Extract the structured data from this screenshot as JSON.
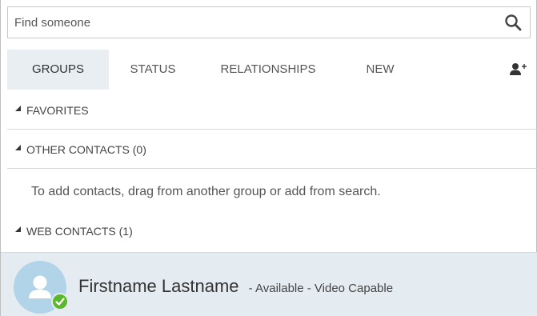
{
  "search": {
    "placeholder": "Find someone",
    "icon": "search-icon"
  },
  "tabs": [
    {
      "label": "GROUPS",
      "active": true
    },
    {
      "label": "STATUS",
      "active": false
    },
    {
      "label": "RELATIONSHIPS",
      "active": false
    },
    {
      "label": "NEW",
      "active": false
    }
  ],
  "add_contact_icon": "add-contact-icon",
  "groups": {
    "favorites": "FAVORITES",
    "other": "OTHER CONTACTS (0)",
    "web": "WEB CONTACTS (1)"
  },
  "empty_hint": "To add contacts, drag from another group or add from search.",
  "contact": {
    "name": "Firstname Lastname",
    "status": "- Available - Video Capable",
    "presence": "available",
    "presence_color": "#5cb82b",
    "avatar_color": "#b2d4e8"
  },
  "colors": {
    "active_tab_bg": "#e8eef2",
    "selected_row_bg": "#e4ecf2"
  }
}
